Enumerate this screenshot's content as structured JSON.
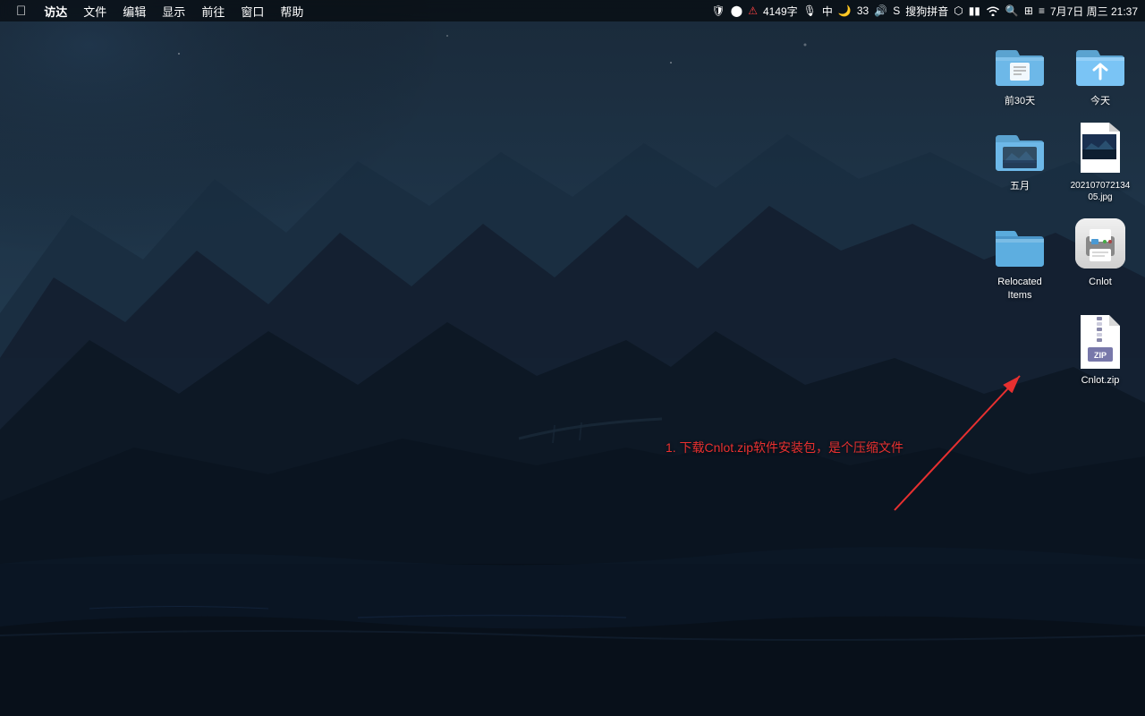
{
  "menubar": {
    "apple": "⌘",
    "app_name": "访达",
    "menus": [
      "文件",
      "编辑",
      "显示",
      "前往",
      "窗口",
      "帮助"
    ],
    "status": {
      "word_count": "4149字",
      "input_indicator": "中",
      "battery_percent": "33",
      "volume": "🔊",
      "input_method": "搜狗拼音",
      "bluetooth": "⬡",
      "battery_icon": "🔋",
      "wifi": "WiFi",
      "datetime": "7月7日 周三  21:37"
    }
  },
  "desktop": {
    "icons": [
      {
        "id": "prev30days",
        "label": "前30天",
        "type": "folder-special"
      },
      {
        "id": "today",
        "label": "今天",
        "type": "folder-today"
      },
      {
        "id": "may",
        "label": "五月",
        "type": "folder-photo"
      },
      {
        "id": "screenshot",
        "label": "20210707213405.jpg",
        "type": "image"
      },
      {
        "id": "relocated",
        "label": "Relocated Items",
        "type": "folder-blue"
      },
      {
        "id": "cnlot",
        "label": "Cnlot",
        "type": "app"
      },
      {
        "id": "cnlot-zip",
        "label": "Cnlot.zip",
        "type": "zip"
      }
    ]
  },
  "annotation": {
    "text": "1. 下载Cnlot.zip软件安装包，是个压缩文件",
    "color": "#e83030"
  }
}
